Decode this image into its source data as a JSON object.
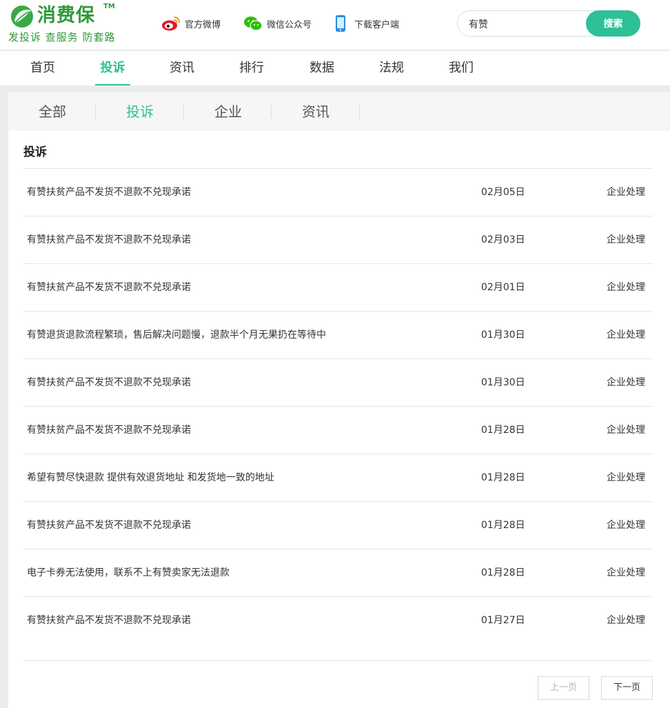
{
  "brand": {
    "name": "消费保",
    "tm": "TM",
    "slogan": "发投诉 查服务 防套路"
  },
  "top_links": [
    {
      "label": "官方微博",
      "icon": "weibo-icon"
    },
    {
      "label": "微信公众号",
      "icon": "wechat-icon"
    },
    {
      "label": "下载客户端",
      "icon": "mobile-phone-icon"
    }
  ],
  "search": {
    "value": "有赞",
    "button_label": "搜索"
  },
  "main_nav": [
    {
      "label": "首页",
      "active": false
    },
    {
      "label": "投诉",
      "active": true
    },
    {
      "label": "资讯",
      "active": false
    },
    {
      "label": "排行",
      "active": false
    },
    {
      "label": "数据",
      "active": false
    },
    {
      "label": "法规",
      "active": false
    },
    {
      "label": "我们",
      "active": false
    }
  ],
  "sub_tabs": [
    {
      "label": "全部",
      "active": false
    },
    {
      "label": "投诉",
      "active": true
    },
    {
      "label": "企业",
      "active": false
    },
    {
      "label": "资讯",
      "active": false
    }
  ],
  "section_title": "投诉",
  "complaints": [
    {
      "title": "有赞扶贫产品不发货不退款不兑现承诺",
      "date": "02月05日",
      "status": "企业处理"
    },
    {
      "title": "有赞扶贫产品不发货不退款不兑现承诺",
      "date": "02月03日",
      "status": "企业处理"
    },
    {
      "title": "有赞扶贫产品不发货不退款不兑现承诺",
      "date": "02月01日",
      "status": "企业处理"
    },
    {
      "title": "有赞退货退款流程繁琐，售后解决问题慢，退款半个月无果扔在等待中",
      "date": "01月30日",
      "status": "企业处理"
    },
    {
      "title": "有赞扶贫产品不发货不退款不兑现承诺",
      "date": "01月30日",
      "status": "企业处理"
    },
    {
      "title": "有赞扶贫产品不发货不退款不兑现承诺",
      "date": "01月28日",
      "status": "企业处理"
    },
    {
      "title": "希望有赞尽快退款 提供有效退货地址 和发货地一致的地址",
      "date": "01月28日",
      "status": "企业处理"
    },
    {
      "title": "有赞扶贫产品不发货不退款不兑现承诺",
      "date": "01月28日",
      "status": "企业处理"
    },
    {
      "title": "电子卡券无法使用，联系不上有赞卖家无法退款",
      "date": "01月28日",
      "status": "企业处理"
    },
    {
      "title": "有赞扶贫产品不发货不退款不兑现承诺",
      "date": "01月27日",
      "status": "企业处理"
    }
  ],
  "pager": {
    "prev_label": "上一页",
    "next_label": "下一页"
  },
  "colors": {
    "accent": "#2ec096",
    "brand_green": "#2f9a39",
    "weibo_red": "#e6162d",
    "wechat_green": "#2dc100",
    "phone_blue": "#2a8ce0"
  }
}
